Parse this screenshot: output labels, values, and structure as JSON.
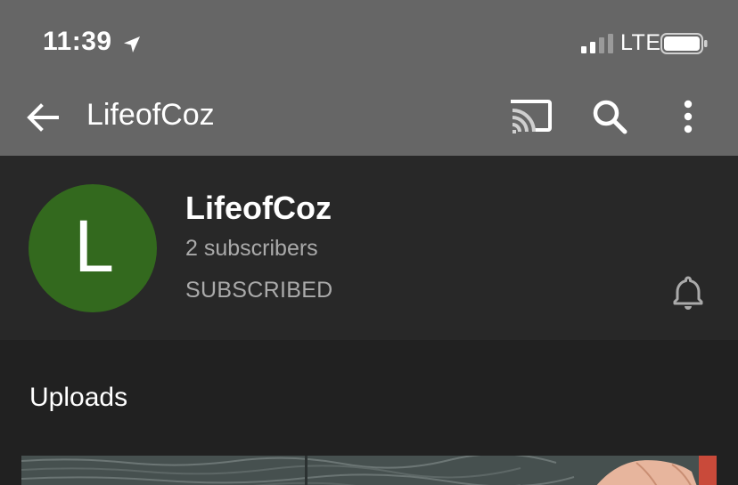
{
  "status_bar": {
    "time": "11:39",
    "network": "LTE"
  },
  "toolbar": {
    "title": "LifeofCoz"
  },
  "channel": {
    "avatar_letter": "L",
    "avatar_color": "#33691e",
    "name": "LifeofCoz",
    "subscribers": "2 subscribers",
    "subscribe_state": "SUBSCRIBED"
  },
  "uploads": {
    "section_title": "Uploads"
  },
  "colors": {
    "appbar": "#666666",
    "header_bg": "#282828",
    "page_bg": "#212121",
    "secondary_text": "#aaaaaa"
  },
  "icons": [
    "location-arrow-icon",
    "signal-bars-icon",
    "battery-icon",
    "back-arrow-icon",
    "cast-icon",
    "search-icon",
    "more-vert-icon",
    "notification-bell-icon"
  ]
}
